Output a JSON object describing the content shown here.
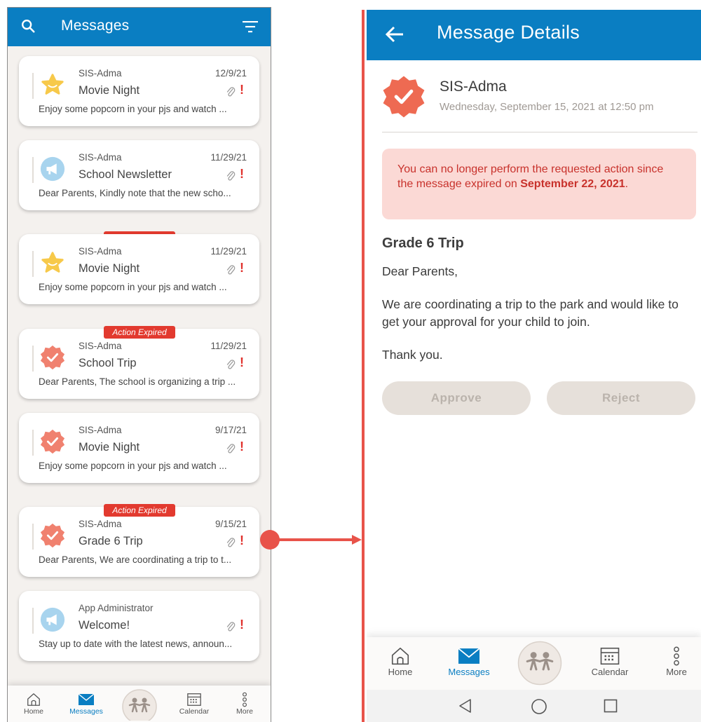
{
  "left": {
    "header": {
      "title": "Messages"
    },
    "messages": [
      {
        "sender": "SIS-Adma",
        "date": "12/9/21",
        "subject": "Movie Night",
        "preview": "Enjoy some popcorn in your pjs and watch ...",
        "icon": "star-icon",
        "badge": ""
      },
      {
        "sender": "SIS-Adma",
        "date": "11/29/21",
        "subject": "School Newsletter",
        "preview": "Dear Parents, Kindly note that the new scho...",
        "icon": "megaphone-icon",
        "badge": ""
      },
      {
        "sender": "SIS-Adma",
        "date": "11/29/21",
        "subject": "Movie Night",
        "preview": "Enjoy some popcorn in your pjs and watch ...",
        "icon": "star-icon",
        "badge": "Action Expired"
      },
      {
        "sender": "SIS-Adma",
        "date": "11/29/21",
        "subject": "School Trip",
        "preview": "Dear Parents, The school is organizing a trip ...",
        "icon": "check-badge-icon",
        "badge": "Action Expired"
      },
      {
        "sender": "SIS-Adma",
        "date": "9/17/21",
        "subject": "Movie Night",
        "preview": "Enjoy some popcorn in your pjs and watch ...",
        "icon": "check-badge-icon",
        "badge": ""
      },
      {
        "sender": "SIS-Adma",
        "date": "9/15/21",
        "subject": "Grade 6 Trip",
        "preview": "Dear Parents, We are coordinating a trip to t...",
        "icon": "check-badge-icon",
        "badge": "Action Expired"
      },
      {
        "sender": "App Administrator",
        "date": "",
        "subject": "Welcome!",
        "preview": "Stay up to date with the latest news, announ...",
        "icon": "megaphone-icon",
        "badge": ""
      }
    ],
    "nav": {
      "home": "Home",
      "messages": "Messages",
      "calendar": "Calendar",
      "more": "More"
    }
  },
  "right": {
    "header": {
      "title": "Message Details"
    },
    "sender": "SIS-Adma",
    "datetime": "Wednesday, September 15, 2021 at 12:50 pm",
    "alert": {
      "text": "You can no longer perform the requested action since the message expired on ",
      "date": "September 22, 2021",
      "end": "."
    },
    "subject": "Grade 6 Trip",
    "body": {
      "greeting": "Dear Parents,",
      "paragraph": "We are coordinating a trip to the park and would like to get your approval for your child to join.",
      "closing": "Thank you."
    },
    "buttons": {
      "approve": "Approve",
      "reject": "Reject"
    },
    "nav": {
      "home": "Home",
      "messages": "Messages",
      "calendar": "Calendar",
      "more": "More"
    }
  },
  "colors": {
    "brand": "#0a7ec2",
    "accent": "#e8534a",
    "expired": "#e23a2f"
  }
}
